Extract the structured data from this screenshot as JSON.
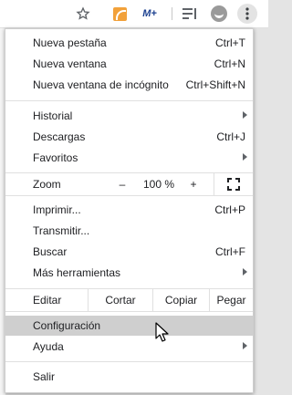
{
  "toolbar": {
    "icons": [
      "star-icon",
      "rss-extension-icon",
      "mplus-extension-icon",
      "media-queue-icon",
      "profile-avatar-icon",
      "menu-kebab-icon"
    ],
    "mplus_label": "M+"
  },
  "menu": {
    "new_tab": {
      "label": "Nueva pestaña",
      "shortcut": "Ctrl+T"
    },
    "new_window": {
      "label": "Nueva ventana",
      "shortcut": "Ctrl+N"
    },
    "incognito": {
      "label": "Nueva ventana de incógnito",
      "shortcut": "Ctrl+Shift+N"
    },
    "history": {
      "label": "Historial"
    },
    "downloads": {
      "label": "Descargas",
      "shortcut": "Ctrl+J"
    },
    "bookmarks": {
      "label": "Favoritos"
    },
    "zoom": {
      "label": "Zoom",
      "minus": "–",
      "value": "100 %",
      "plus": "+"
    },
    "print": {
      "label": "Imprimir...",
      "shortcut": "Ctrl+P"
    },
    "cast": {
      "label": "Transmitir..."
    },
    "find": {
      "label": "Buscar",
      "shortcut": "Ctrl+F"
    },
    "more_tools": {
      "label": "Más herramientas"
    },
    "edit": {
      "label": "Editar",
      "cut": "Cortar",
      "copy": "Copiar",
      "paste": "Pegar"
    },
    "settings": {
      "label": "Configuración"
    },
    "help": {
      "label": "Ayuda"
    },
    "exit": {
      "label": "Salir"
    }
  }
}
